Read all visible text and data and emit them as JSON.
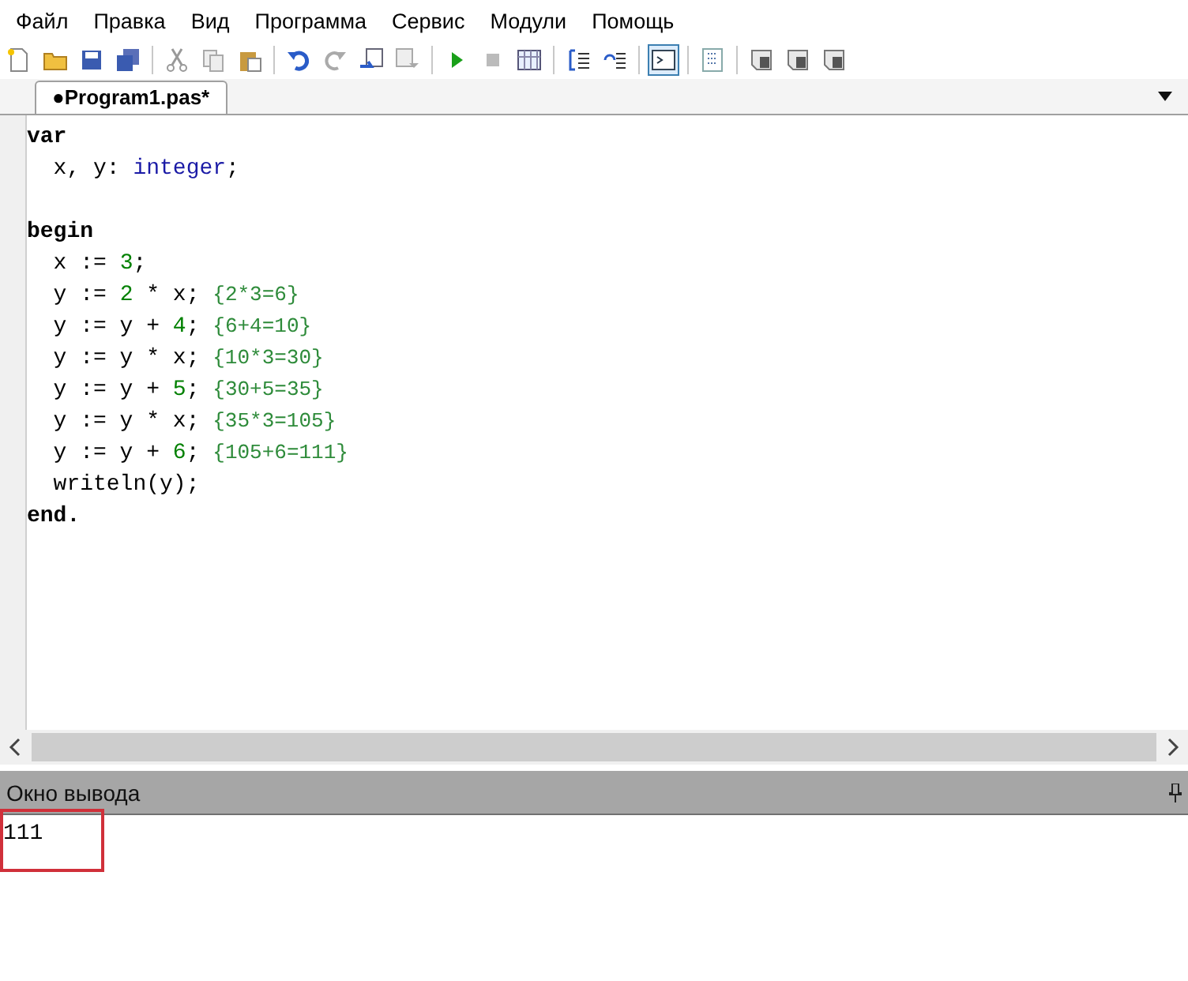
{
  "menu": [
    "Файл",
    "Правка",
    "Вид",
    "Программа",
    "Сервис",
    "Модули",
    "Помощь"
  ],
  "toolbar": [
    {
      "kind": "new"
    },
    {
      "kind": "open"
    },
    {
      "kind": "save"
    },
    {
      "kind": "save-all"
    },
    {
      "kind": "separator"
    },
    {
      "kind": "cut"
    },
    {
      "kind": "copy"
    },
    {
      "kind": "paste"
    },
    {
      "kind": "separator"
    },
    {
      "kind": "undo"
    },
    {
      "kind": "redo"
    },
    {
      "kind": "indent"
    },
    {
      "kind": "outdent"
    },
    {
      "kind": "separator"
    },
    {
      "kind": "run"
    },
    {
      "kind": "stop"
    },
    {
      "kind": "grid"
    },
    {
      "kind": "separator"
    },
    {
      "kind": "step-in"
    },
    {
      "kind": "step-over"
    },
    {
      "kind": "separator"
    },
    {
      "kind": "console",
      "pressed": true
    },
    {
      "kind": "separator"
    },
    {
      "kind": "list"
    },
    {
      "kind": "separator"
    },
    {
      "kind": "doc"
    },
    {
      "kind": "doc"
    },
    {
      "kind": "doc"
    }
  ],
  "tab": {
    "label": "●Program1.pas*",
    "selected": true
  },
  "code": [
    [
      {
        "t": "var",
        "kind": "keyword"
      }
    ],
    [
      {
        "t": "  x, y: ",
        "kind": "plain"
      },
      {
        "t": "integer",
        "kind": "type"
      },
      {
        "t": ";",
        "kind": "plain"
      }
    ],
    [
      {
        "kind": "blank"
      }
    ],
    [
      {
        "t": "begin",
        "kind": "keyword"
      }
    ],
    [
      {
        "t": "  x := ",
        "kind": "plain"
      },
      {
        "t": "3",
        "kind": "number"
      },
      {
        "t": ";",
        "kind": "plain"
      }
    ],
    [
      {
        "t": "  y := ",
        "kind": "plain"
      },
      {
        "t": "2",
        "kind": "number"
      },
      {
        "t": " * x; ",
        "kind": "plain"
      },
      {
        "t": "{2*3=6}",
        "kind": "comment"
      }
    ],
    [
      {
        "t": "  y := y + ",
        "kind": "plain"
      },
      {
        "t": "4",
        "kind": "number"
      },
      {
        "t": "; ",
        "kind": "plain"
      },
      {
        "t": "{6+4=10}",
        "kind": "comment"
      }
    ],
    [
      {
        "t": "  y := y * x; ",
        "kind": "plain"
      },
      {
        "t": "{10*3=30}",
        "kind": "comment"
      }
    ],
    [
      {
        "t": "  y := y + ",
        "kind": "plain"
      },
      {
        "t": "5",
        "kind": "number"
      },
      {
        "t": "; ",
        "kind": "plain"
      },
      {
        "t": "{30+5=35}",
        "kind": "comment"
      }
    ],
    [
      {
        "t": "  y := y * x; ",
        "kind": "plain"
      },
      {
        "t": "{35*3=105}",
        "kind": "comment"
      }
    ],
    [
      {
        "t": "  y := y + ",
        "kind": "plain"
      },
      {
        "t": "6",
        "kind": "number"
      },
      {
        "t": "; ",
        "kind": "plain"
      },
      {
        "t": "{105+6=111}",
        "kind": "comment"
      }
    ],
    [
      {
        "t": "  writeln(y);",
        "kind": "plain"
      }
    ],
    [
      {
        "t": "end.",
        "kind": "keyword"
      }
    ]
  ],
  "output": {
    "title": "Окно вывода",
    "text": "111",
    "highlighted": true
  }
}
